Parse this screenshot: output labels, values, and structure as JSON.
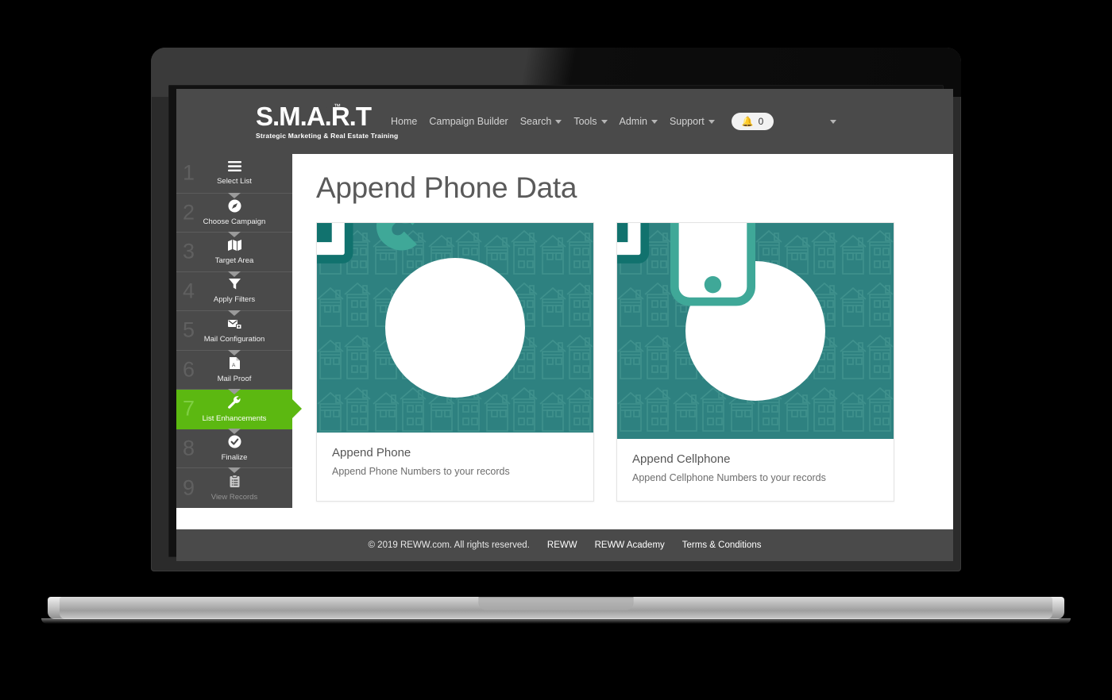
{
  "brand": {
    "logo_text": "S.M.A.R.T",
    "logo_amp": "&",
    "logo_tm": "™",
    "tagline": "Strategic Marketing & Real Estate Training"
  },
  "nav": {
    "items": [
      {
        "label": "Home",
        "has_caret": false
      },
      {
        "label": "Campaign Builder",
        "has_caret": false
      },
      {
        "label": "Search",
        "has_caret": true
      },
      {
        "label": "Tools",
        "has_caret": true
      },
      {
        "label": "Admin",
        "has_caret": true
      },
      {
        "label": "Support",
        "has_caret": true
      }
    ],
    "notifications": {
      "icon": "bell-icon",
      "count": "0"
    },
    "user_menu_icon": "chevron-down-icon"
  },
  "sidebar": {
    "steps": [
      {
        "num": "1",
        "label": "Select List",
        "icon": "hamburger-icon",
        "state": "enabled"
      },
      {
        "num": "2",
        "label": "Choose Campaign",
        "icon": "compass-icon",
        "state": "enabled"
      },
      {
        "num": "3",
        "label": "Target Area",
        "icon": "map-icon",
        "state": "enabled"
      },
      {
        "num": "4",
        "label": "Apply Filters",
        "icon": "funnel-icon",
        "state": "enabled"
      },
      {
        "num": "5",
        "label": "Mail Configuration",
        "icon": "mail-stack-icon",
        "state": "enabled"
      },
      {
        "num": "6",
        "label": "Mail Proof",
        "icon": "pdf-document-icon",
        "state": "enabled"
      },
      {
        "num": "7",
        "label": "List Enhancements",
        "icon": "wrench-icon",
        "state": "active"
      },
      {
        "num": "8",
        "label": "Finalize",
        "icon": "check-circle-icon",
        "state": "enabled"
      },
      {
        "num": "9",
        "label": "View Records",
        "icon": "clipboard-icon",
        "state": "disabled"
      }
    ]
  },
  "main": {
    "page_title": "Append Phone Data",
    "cards": [
      {
        "title": "Append Phone",
        "description": "Append Phone Numbers to your records",
        "icon": "monitor-arrow-handset-icon"
      },
      {
        "title": "Append Cellphone",
        "description": "Append Cellphone Numbers to your records",
        "icon": "monitor-arrow-smartphone-icon"
      }
    ]
  },
  "footer": {
    "copyright": "© 2019 REWW.com. All rights reserved.",
    "links": [
      "REWW",
      "REWW Academy",
      "Terms & Conditions"
    ]
  },
  "colors": {
    "header_bg": "#4a4a4a",
    "active_step": "#5cb811",
    "card_media_teal": "#2e8180",
    "accent_blue": "#1b84d6",
    "icon_teal": "#11726e"
  }
}
